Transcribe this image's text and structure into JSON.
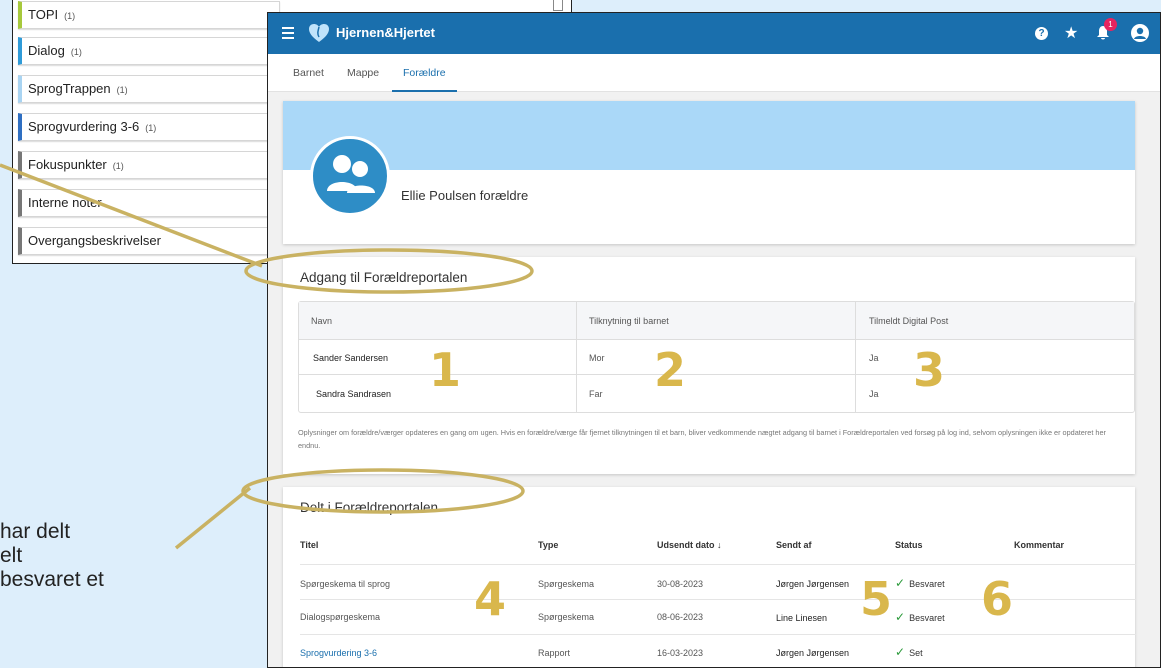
{
  "background_text": {
    "lines": [
      "har delt",
      "elt",
      "besvaret et"
    ]
  },
  "left_list": {
    "items": [
      {
        "label": "TOPI",
        "count": "(1)",
        "color": "#a7c93c"
      },
      {
        "label": "Dialog",
        "count": "(1)",
        "color": "#2f9bd8"
      },
      {
        "label": "SprogTrappen",
        "count": "(1)",
        "color": "#a9d4f2"
      },
      {
        "label": "Sprogvurdering 3-6",
        "count": "(1)",
        "color": "#2f6fc2"
      },
      {
        "label": "Fokuspunkter",
        "count": "(1)",
        "color": "#777777"
      },
      {
        "label": "Interne noter",
        "count": "",
        "color": "#777777"
      },
      {
        "label": "Overgangsbeskrivelser",
        "count": "",
        "color": "#777777"
      }
    ]
  },
  "app": {
    "brand": "Hjernen&Hjertet",
    "notification_count": "1",
    "tabs": [
      "Barnet",
      "Mappe",
      "Forældre"
    ],
    "active_tab_index": 2,
    "colors": {
      "primary": "#1a6fad",
      "banner": "#aad8f8",
      "annotation": "#d9b74c",
      "success": "#2b9a3a"
    }
  },
  "profile": {
    "name": "Ellie Poulsen forældre"
  },
  "access": {
    "title": "Adgang til Forældreportalen",
    "headers": [
      "Navn",
      "Tilknytning til barnet",
      "Tilmeldt Digital Post"
    ],
    "rows": [
      [
        "Sander Sandersen",
        "Mor",
        "Ja"
      ],
      [
        "Sandra Sandrasen",
        "Far",
        "Ja"
      ]
    ],
    "note": "Oplysninger om forældre/værger opdateres en gang om ugen. Hvis en forældre/værge får fjernet tilknytningen til et barn, bliver vedkommende nægtet adgang til barnet i Forældreportalen ved forsøg på log ind, selvom oplysningen ikke er opdateret her endnu."
  },
  "shared": {
    "title": "Delt i Forældreportalen",
    "headers": [
      "Titel",
      "Type",
      "Udsendt dato ↓",
      "Sendt af",
      "Status",
      "Kommentar"
    ],
    "rows": [
      [
        "Spørgeskema til sprog",
        "Spørgeskema",
        "30-08-2023",
        "Jørgen Jørgensen",
        "Besvaret",
        ""
      ],
      [
        "Dialogspørgeskema",
        "Spørgeskema",
        "08-06-2023",
        "Line Linesen",
        "Besvaret",
        ""
      ],
      [
        "Sprogvurdering 3-6",
        "Rapport",
        "16-03-2023",
        "Jørgen Jørgensen",
        "Set",
        ""
      ]
    ]
  },
  "annotations": {
    "numbers": [
      "1",
      "2",
      "3",
      "4",
      "5",
      "6"
    ]
  }
}
